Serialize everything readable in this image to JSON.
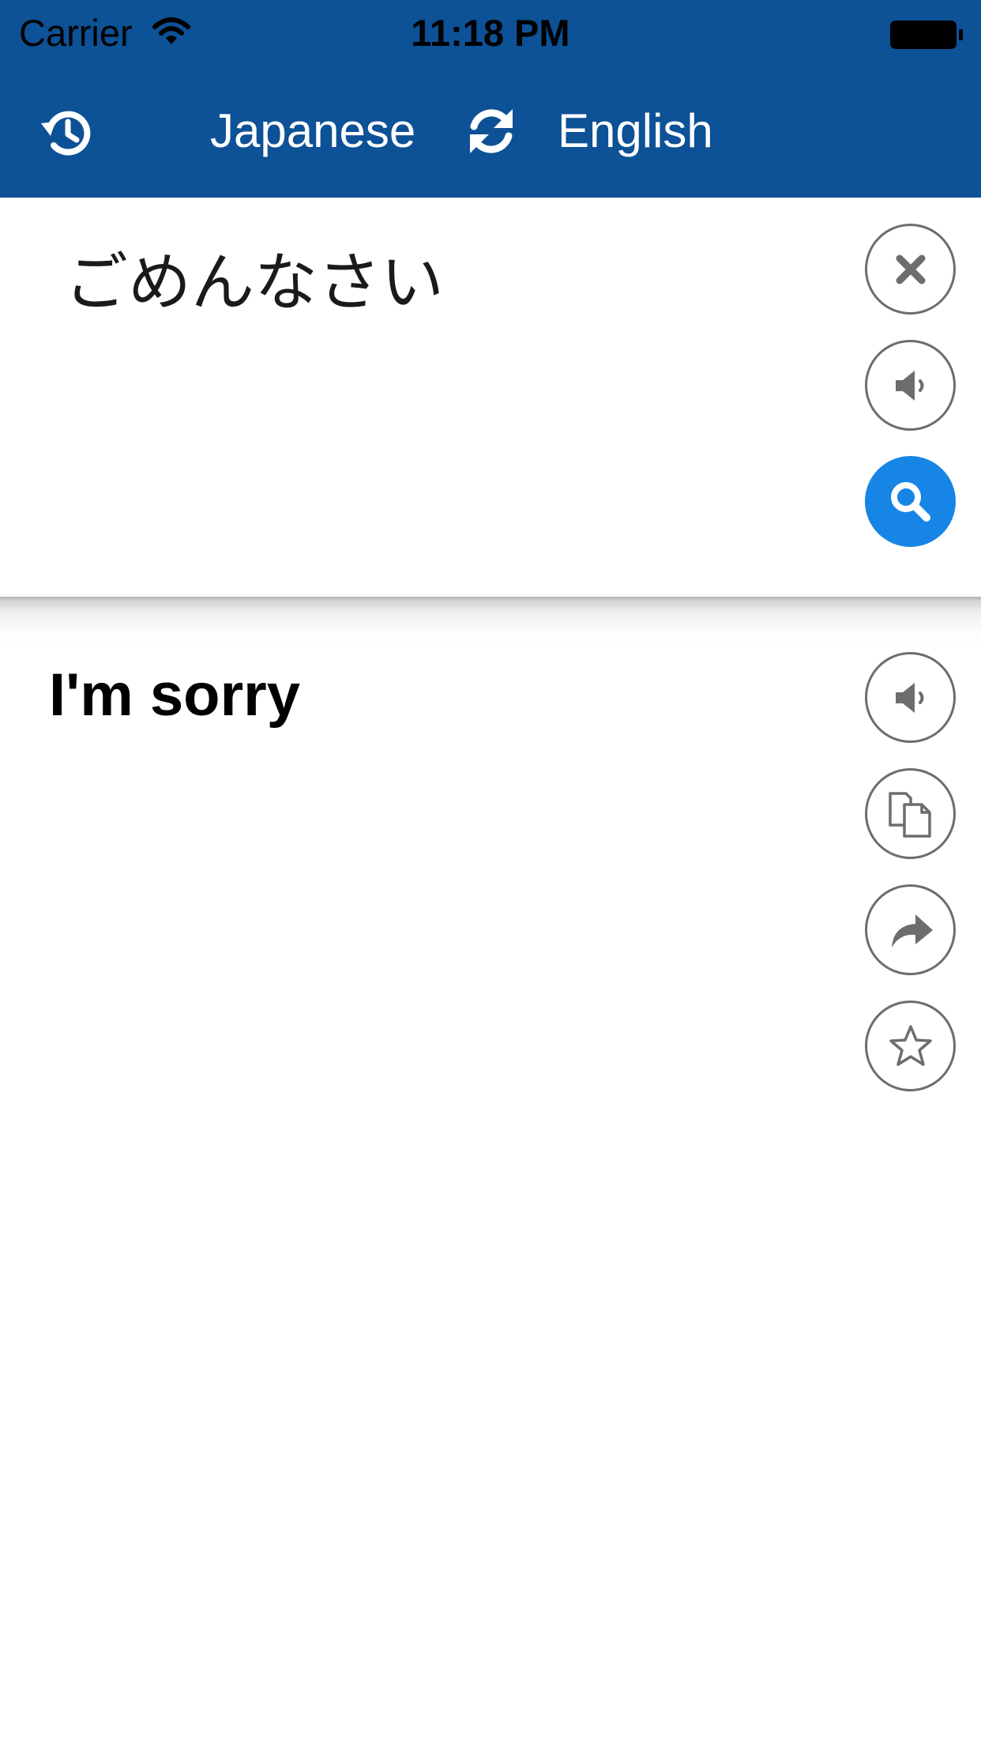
{
  "status_bar": {
    "carrier": "Carrier",
    "time": "11:18 PM"
  },
  "nav": {
    "source_language": "Japanese",
    "target_language": "English",
    "history_icon": "history-icon",
    "swap_icon": "swap-icon"
  },
  "input": {
    "text": "ごめんなさい",
    "actions": [
      "clear",
      "speak",
      "search"
    ]
  },
  "output": {
    "text": "I'm sorry",
    "actions": [
      "speak",
      "copy",
      "share",
      "favorite"
    ]
  },
  "colors": {
    "header_bg": "#0d5196",
    "accent": "#1785e6",
    "icon_gray": "#6d6d6d"
  }
}
